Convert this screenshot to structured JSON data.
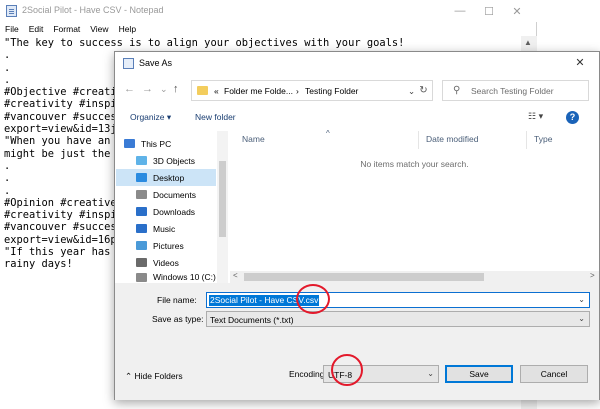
{
  "notepad": {
    "title": "2Social Pilot - Have CSV - Notepad",
    "menu": [
      "File",
      "Edit",
      "Format",
      "View",
      "Help"
    ],
    "lines": [
      "\"The key to success is to align your objectives with your goals!",
      ".",
      ".",
      ".",
      "#Objective #creati",
      "#creativity #inspi",
      "#vancouver #succes",
      "export=view&id=13j",
      "\"When you have an",
      "might be just the",
      ".",
      ".",
      ".",
      "#Opinion #creative",
      "#creativity #inspi",
      "#vancouver #succes",
      "export=view&id=16p",
      "\"If this year has",
      "rainy days!"
    ],
    "window_buttons": [
      "—",
      "☐",
      "✕"
    ]
  },
  "dialog": {
    "title": "Save As",
    "close": "✕",
    "nav": {
      "back": "←",
      "forward": "→",
      "up_dropdown": "⌄",
      "up": "↑"
    },
    "address": {
      "prefix": "«",
      "crumbs": [
        "Folder me Folde...",
        "Testing Folder"
      ],
      "sep": "›",
      "dropdown": "⌄"
    },
    "refresh": "↻",
    "search_placeholder": "Search Testing Folder",
    "toolbar": {
      "organize": "Organize ▾",
      "new_folder": "New folder",
      "view": "☷ ▾",
      "help": "?"
    },
    "sidebar": [
      {
        "label": "This PC",
        "icon": "computer-icon",
        "color": "#3a7bd5"
      },
      {
        "label": "3D Objects",
        "icon": "cube-icon",
        "color": "#5fb3e8"
      },
      {
        "label": "Desktop",
        "icon": "desktop-icon",
        "color": "#2a8be0"
      },
      {
        "label": "Documents",
        "icon": "documents-icon",
        "color": "#8a8a8a"
      },
      {
        "label": "Downloads",
        "icon": "download-icon",
        "color": "#2a6fc9"
      },
      {
        "label": "Music",
        "icon": "music-icon",
        "color": "#2a6fc9"
      },
      {
        "label": "Pictures",
        "icon": "pictures-icon",
        "color": "#4a9ad8"
      },
      {
        "label": "Videos",
        "icon": "videos-icon",
        "color": "#6a6a6a"
      },
      {
        "label": "Windows 10 (C:)",
        "icon": "drive-icon",
        "color": "#8a8a8a"
      }
    ],
    "selected_sidebar": "Desktop",
    "columns": {
      "name": "Name",
      "date_modified": "Date modified",
      "type": "Type",
      "sort_indicator": "^"
    },
    "empty_message": "No items match your search.",
    "scroll": {
      "left": "<",
      "right": ">"
    },
    "file_name_label": "File name:",
    "file_name_value": "2Social Pilot - Have CSV.csv",
    "save_as_type_label": "Save as type:",
    "save_as_type_value": "Text Documents (*.txt)",
    "hide_folders": "Hide Folders",
    "encoding_label": "Encoding:",
    "encoding_value": "UTF-8",
    "save_button": "Save",
    "cancel_button": "Cancel"
  },
  "colors": {
    "selection": "#0078d7",
    "annotation": "#e3192b",
    "sidebar_selected": "#cce4f7"
  }
}
